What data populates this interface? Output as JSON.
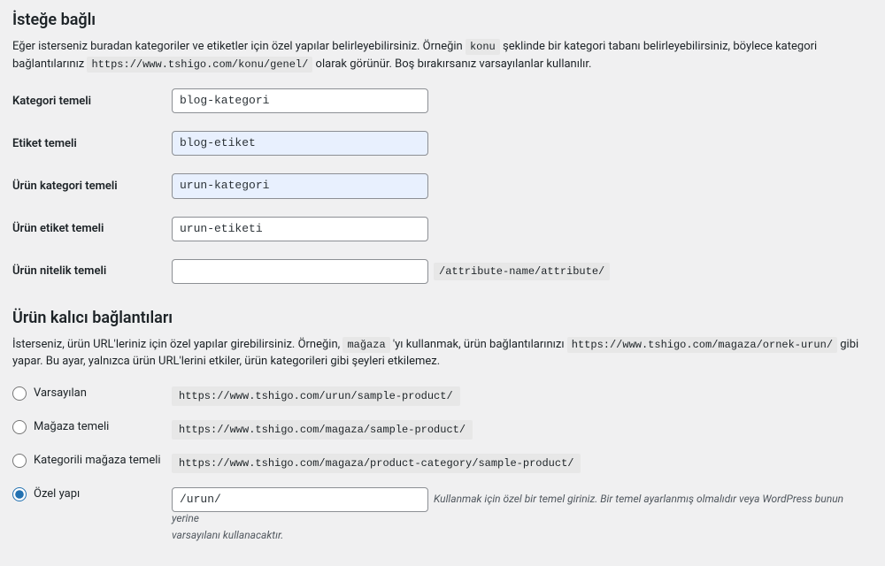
{
  "optional": {
    "heading": "İsteğe bağlı",
    "desc_pre": "Eğer isterseniz buradan kategoriler ve etiketler için özel yapılar belirleyebilirsiniz. Örneğin ",
    "desc_code1": "konu",
    "desc_mid": " şeklinde bir kategori tabanı belirleyebilirsiniz, böylece kategori bağlantılarınız ",
    "desc_code2": "https://www.tshigo.com/konu/genel/",
    "desc_post": " olarak görünür. Boş bırakırsanız varsayılanlar kullanılır."
  },
  "fields": {
    "category_base": {
      "label": "Kategori temeli",
      "value": "blog-kategori"
    },
    "tag_base": {
      "label": "Etiket temeli",
      "value": "blog-etiket"
    },
    "product_cat_base": {
      "label": "Ürün kategori temeli",
      "value": "urun-kategori"
    },
    "product_tag_base": {
      "label": "Ürün etiket temeli",
      "value": "urun-etiketi"
    },
    "product_attr_base": {
      "label": "Ürün nitelik temeli",
      "value": "",
      "suffix": "/attribute-name/attribute/"
    }
  },
  "permalinks": {
    "heading": "Ürün kalıcı bağlantıları",
    "desc_pre": "İsterseniz, ürün URL'leriniz için özel yapılar girebilirsiniz. Örneğin, ",
    "desc_code1": "mağaza",
    "desc_mid": " 'yı kullanmak, ürün bağlantılarınızı ",
    "desc_code2": "https://www.tshigo.com/magaza/ornek-urun/",
    "desc_post": " gibi yapar. Bu ayar, yalnızca ürün URL'lerini etkiler, ürün kategorileri gibi şeyleri etkilemez."
  },
  "radios": {
    "default": {
      "label": "Varsayılan",
      "example": "https://www.tshigo.com/urun/sample-product/"
    },
    "shop": {
      "label": "Mağaza temeli",
      "example": "https://www.tshigo.com/magaza/sample-product/"
    },
    "shop_cat": {
      "label": "Kategorili mağaza temeli",
      "example": "https://www.tshigo.com/magaza/product-category/sample-product/"
    },
    "custom": {
      "label": "Özel yapı",
      "value": "/urun/",
      "hint1": "Kullanmak için özel bir temel giriniz. Bir temel ayarlanmış olmalıdır veya WordPress bunun yerine",
      "hint2": "varsayılanı kullanacaktır."
    }
  }
}
